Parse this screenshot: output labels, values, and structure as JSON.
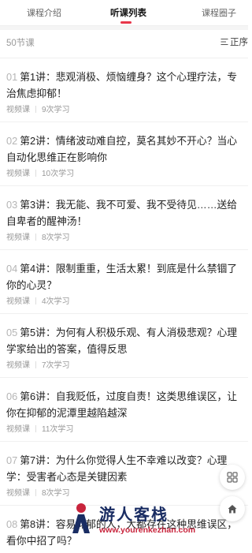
{
  "tabs": [
    {
      "label": "课程介绍",
      "active": false
    },
    {
      "label": "听课列表",
      "active": true
    },
    {
      "label": "课程圈子",
      "active": false
    }
  ],
  "summary": {
    "count_label": "50节课",
    "sort_label": "正序"
  },
  "lessons": [
    {
      "num": "01",
      "title": "第1讲：悲观消极、烦恼缠身？这个心理疗法，专治焦虑抑郁！",
      "type": "视频课",
      "plays": "9次学习"
    },
    {
      "num": "02",
      "title": "第2讲：情绪波动难自控，莫名其妙不开心？当心自动化思维正在影响你",
      "type": "视频课",
      "plays": "10次学习"
    },
    {
      "num": "03",
      "title": "第3讲：我无能、我不可爱、我不受待见……送给自卑者的醒神汤！",
      "type": "视频课",
      "plays": "8次学习"
    },
    {
      "num": "04",
      "title": "第4讲：限制重重，生活太累！到底是什么禁锢了你的心灵？",
      "type": "视频课",
      "plays": "4次学习"
    },
    {
      "num": "05",
      "title": "第5讲：为何有人积极乐观、有人消极悲观？心理学家给出的答案，值得反思",
      "type": "视频课",
      "plays": "7次学习"
    },
    {
      "num": "06",
      "title": "第6讲：自我贬低，过度自责！这类思维误区，让你在抑郁的泥潭里越陷越深",
      "type": "视频课",
      "plays": "11次学习"
    },
    {
      "num": "07",
      "title": "第7讲：为什么你觉得人生不幸难以改变？心理学：受害者心态是关键因素",
      "type": "视频课",
      "plays": "8次学习"
    },
    {
      "num": "08",
      "title": "第8讲：容易抑郁的人，大都存在这种思维误区，看你中招了吗？",
      "type": "视频课",
      "plays": ""
    }
  ],
  "watermark": {
    "name": "游人客栈",
    "url": "www.yourenkezhan.com"
  },
  "icons": {
    "sort": "sort-lines-icon",
    "grid": "grid-icon",
    "home": "home-icon",
    "logo": "youren-logo-icon"
  },
  "colors": {
    "accent": "#e8364a",
    "watermark_navy": "#1a2d63",
    "watermark_red": "#c8243c"
  }
}
